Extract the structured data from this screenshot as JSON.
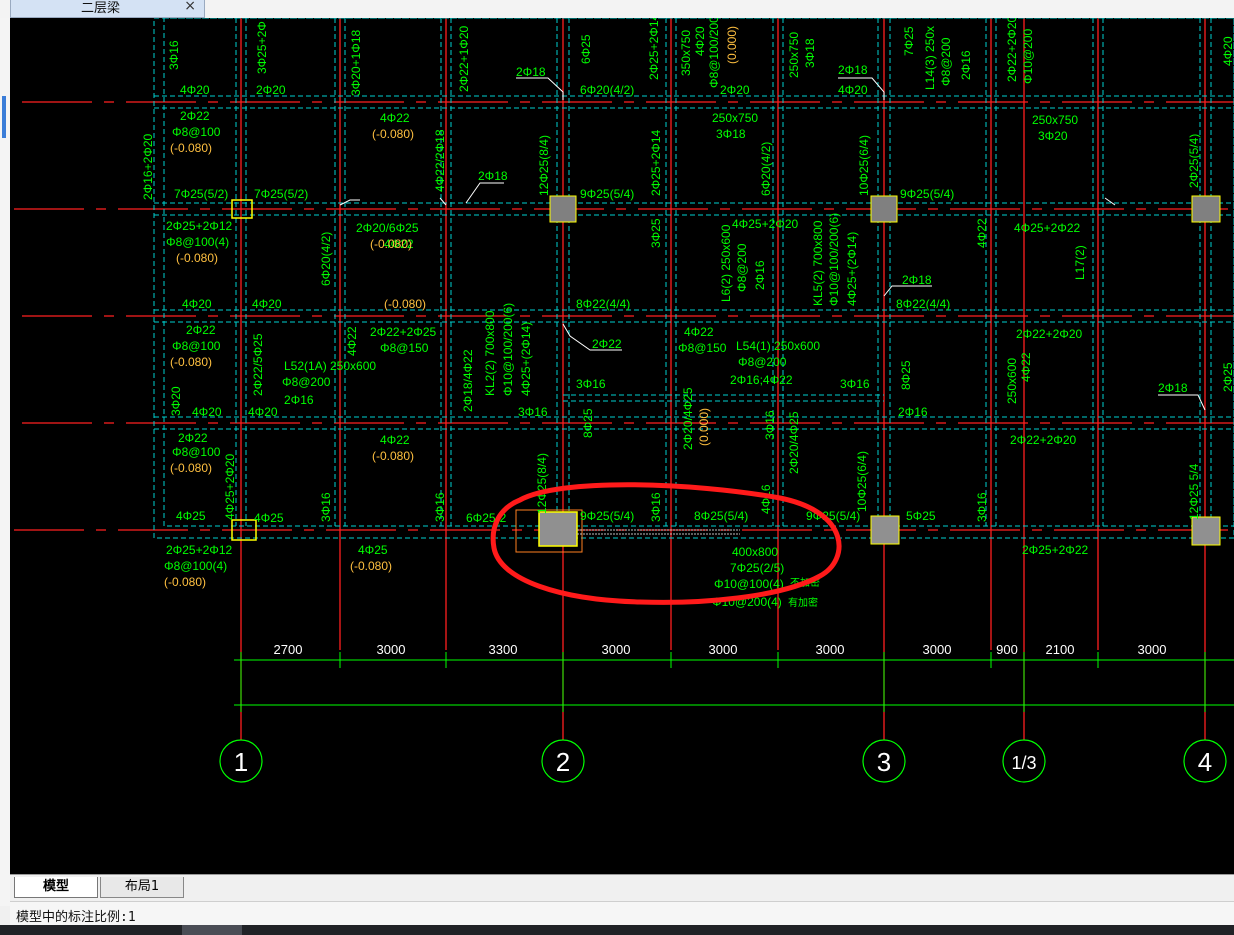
{
  "window": {
    "doc_tab": "二层梁",
    "close_glyph": "×"
  },
  "drawing": {
    "colors": {
      "bg": "#000000",
      "axis": "#ff2020",
      "beam": "#00d0d0",
      "text": "#00ff00",
      "elev": "#ffc040",
      "white": "#ffffff",
      "markup": "#ff1a1a",
      "column": "#ffff00"
    },
    "texts": {
      "t01": "3Φ16",
      "t02": "3Φ25+2Φ",
      "t03": "3Φ20+1Φ18",
      "t04": "2Φ22+1Φ20",
      "t05": "6Φ25",
      "t06": "2Φ25+2Φ14",
      "t07": "350x750",
      "t08": "4Φ20",
      "t09": "Φ8@100/200",
      "t10": "(0.000)",
      "t11": "250x750",
      "t12": "3Φ18",
      "t13": "7Φ25",
      "t14": "L14(3) 250x",
      "t15": "Φ8@200",
      "t16": "2Φ16",
      "t17": "2Φ22+2Φ20",
      "t18": "Φ10@200",
      "t19": "4Φ20",
      "t20": "2Φ18",
      "t21": "6Φ20(4/2)",
      "t22": "2Φ20",
      "t23": "4Φ20",
      "t24": "2Φ18",
      "t25": "4Φ20",
      "t26": "2Φ20",
      "t27": "4Φ22",
      "t28": "(-0.080)",
      "t29": "250x750",
      "t30": "3Φ18",
      "t31": "250x750",
      "t32": "3Φ20",
      "t33": "2Φ22",
      "t34": "Φ8@100",
      "t35": "(-0.080)",
      "t36": "2Φ16+2Φ20",
      "t37": "4Φ22/2Φ18",
      "t38": "2Φ18",
      "t39": "12Φ25(8/4)",
      "t40": "2Φ25+2Φ14",
      "t41": "6Φ20(4/2)",
      "t42": "10Φ25(6/4)",
      "t43": "2Φ25(5/4)",
      "t44": "7Φ25(5/2)",
      "t45": "7Φ25(5/2)",
      "t46": "9Φ25(5/4)",
      "t47": "9Φ25(5/4)",
      "t48": "2Φ25+2Φ12",
      "t49": "Φ8@100(4)",
      "t50": "(-0.080)",
      "t51": "2Φ20/6Φ25",
      "t52": "4Φ22",
      "t53": "(-0.080)",
      "t54": "6Φ20(4/2)",
      "t55": "3Φ25",
      "t56": "4Φ25+2Φ20",
      "t57": "4Φ22",
      "t58": "4Φ25+2Φ22",
      "t59": "L6(2) 250x600",
      "t60": "Φ8@200",
      "t61": "2Φ16",
      "t62": "KL5(2) 700x800",
      "t63": "Φ10@100/200(6)",
      "t64": "4Φ25+(2Φ14)",
      "t65": "L17(2)",
      "t66": "4Φ20",
      "t67": "4Φ20",
      "t68": "(-0.080)",
      "t69": "8Φ22(4/4)",
      "t70": "2Φ18",
      "t71": "8Φ22(4/4)",
      "t72": "2Φ22",
      "t73": "Φ8@100",
      "t74": "(-0.080)",
      "t75": "2Φ22/5Φ25",
      "t76": "L52(1A)",
      "t77": "Φ8@200",
      "t78": "2Φ16",
      "t79": "250x600",
      "t80": "4Φ22",
      "t81": "2Φ22+2Φ25",
      "t82": "Φ8@150",
      "t83": "2Φ18/4Φ22",
      "t84": "KL2(2) 700x800",
      "t85": "Φ10@100/200(6)",
      "t86": "4Φ25+(2Φ14)",
      "t87": "2Φ22",
      "t88": "4Φ22",
      "t89": "Φ8@150",
      "t90": "L54(1) 250x600",
      "t91": "Φ8@200",
      "t92": "2Φ16;4Φ22",
      "t93": "3Φ16",
      "t94": "3Φ16",
      "t95": "8Φ25",
      "t96": "2Φ22+2Φ20",
      "t97": "250x600",
      "t98": "4Φ22",
      "t99": "2Φ18",
      "t100": "2Φ25",
      "t101": "3Φ20",
      "t102": "4Φ20",
      "t103": "4Φ20",
      "t104": "3Φ16",
      "t105": "8Φ25",
      "t106": "2Φ20/4Φ25",
      "t107": "(0.000)",
      "t108": "2Φ20/4Φ25",
      "t109": "3Φ16",
      "t110": "2Φ16",
      "t111": "2Φ22",
      "t112": "Φ8@100",
      "t113": "(-0.080)",
      "t114": "4Φ22",
      "t115": "(-0.080)",
      "t116": "2Φ22+2Φ20",
      "t117": "4Φ25",
      "t118": "4Φ25",
      "t119": "4Φ25+2Φ20",
      "t120": "3Φ16",
      "t121": "3Φ16",
      "t122": "12Φ25(8/4)",
      "t123": "6Φ25(2",
      "t124": "9Φ25(5/4)",
      "t125": "3Φ16",
      "t126": "8Φ25(5/4)",
      "t127": "4Φ16",
      "t128": "9Φ25(5/4)",
      "t129": "10Φ25(6/4)",
      "t130": "5Φ25",
      "t131": "3Φ16",
      "t132": "12Φ25 5/4",
      "t133": "2Φ25+2Φ12",
      "t134": "Φ8@100(4)",
      "t135": "(-0.080)",
      "t136": "4Φ25",
      "t137": "(-0.080)",
      "t138": "400x800",
      "t139": "7Φ25(2/5)",
      "t140": "Φ10@100(4)",
      "t141": "Φ10@200(4)",
      "t142": "2Φ25+2Φ22",
      "t143": "不加密",
      "t144": "有加密"
    },
    "dimensions": [
      "2700",
      "3000",
      "3300",
      "3000",
      "3000",
      "3000",
      "3000",
      "900",
      "2100",
      "3000"
    ],
    "axis_labels": [
      "1",
      "2",
      "3",
      "1/3",
      "4"
    ]
  },
  "layout_tabs": [
    "模型",
    "布局1"
  ],
  "status": {
    "text": "模型中的标注比例:1"
  }
}
